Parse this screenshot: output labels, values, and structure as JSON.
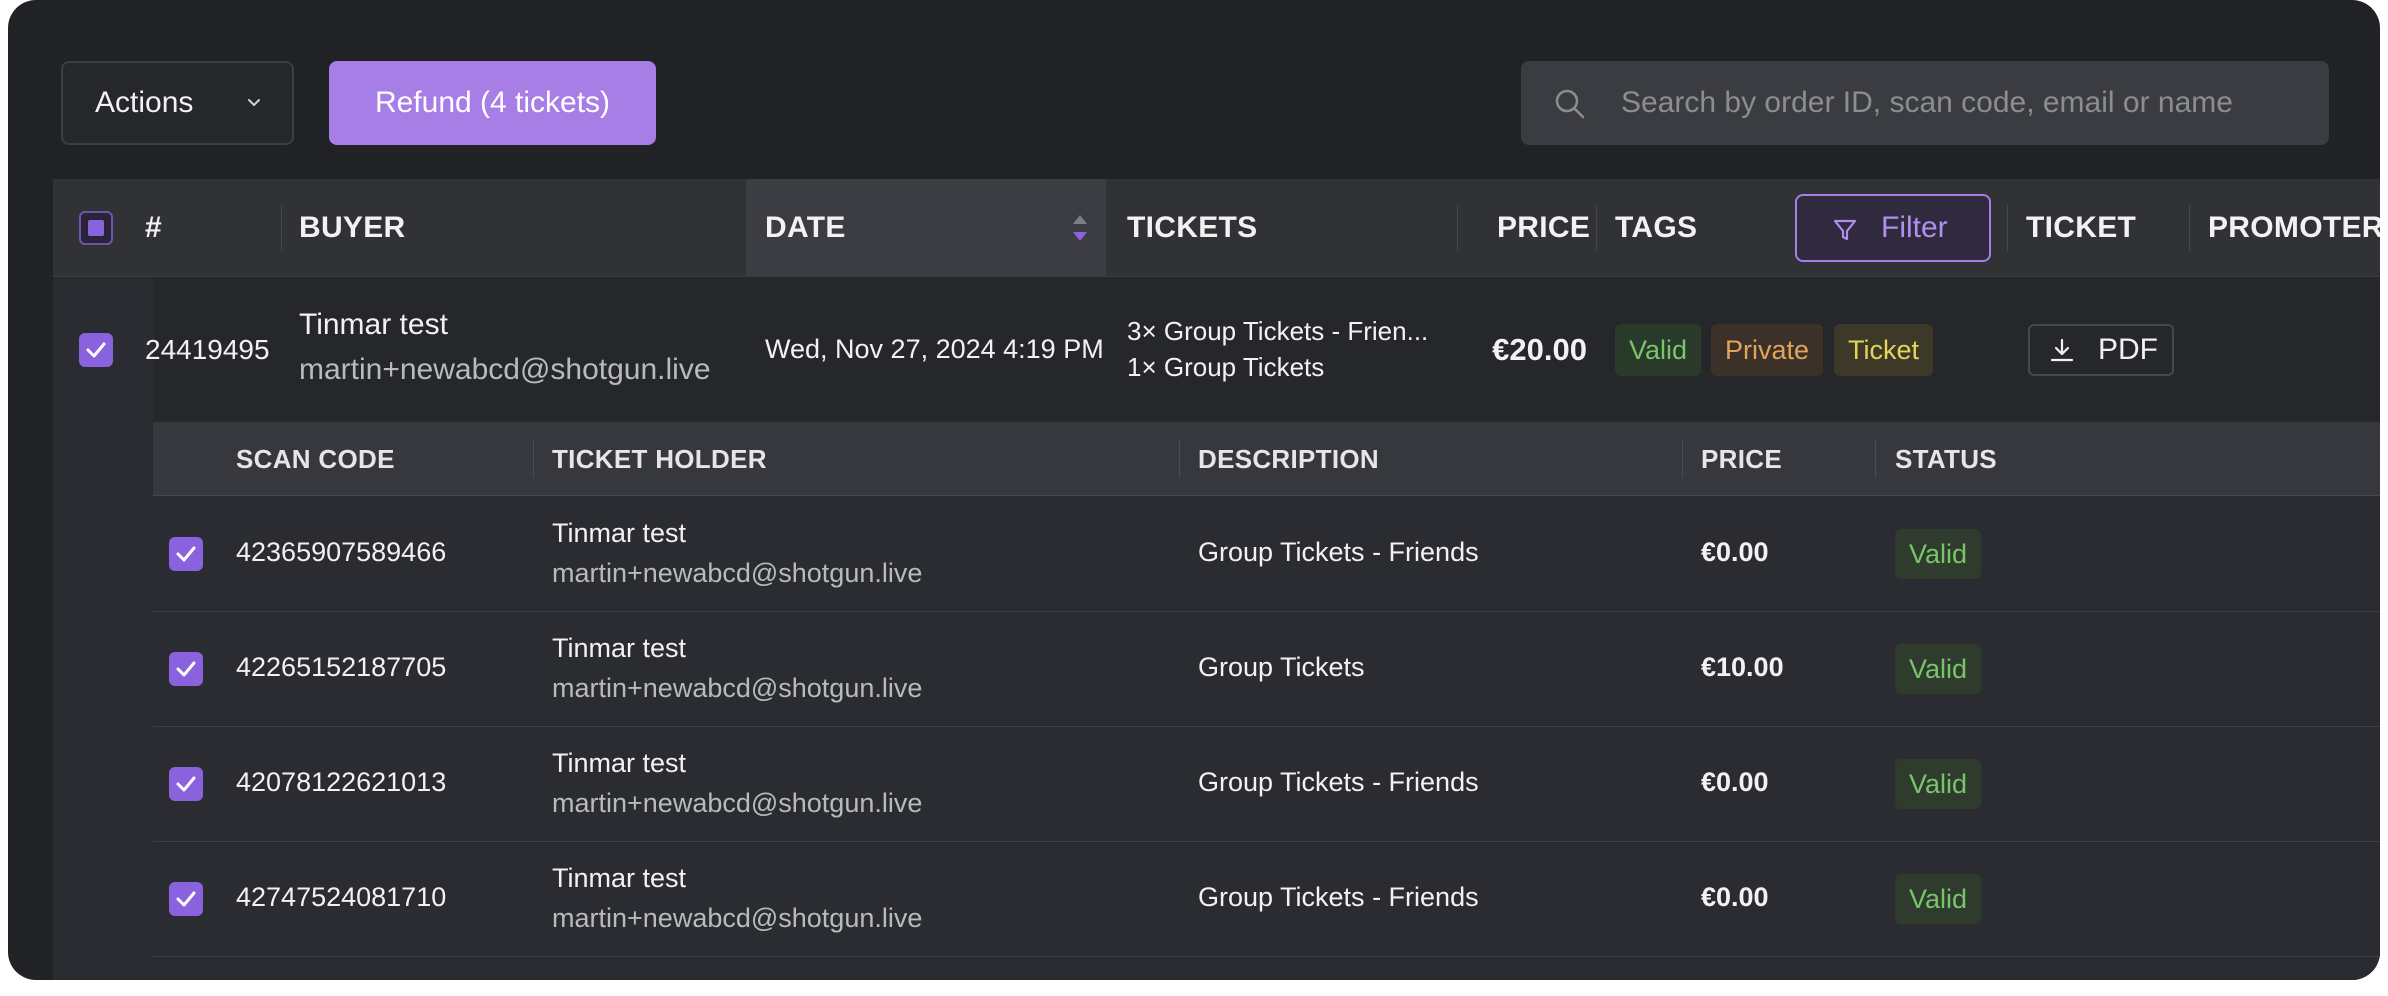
{
  "toolbar": {
    "actions_label": "Actions",
    "refund_label": "Refund (4 tickets)",
    "search_placeholder": "Search by order ID, scan code, email or name"
  },
  "columns": {
    "number": "#",
    "buyer": "BUYER",
    "date": "DATE",
    "tickets": "TICKETS",
    "price": "PRICE",
    "tags": "TAGS",
    "filter": "Filter",
    "ticket": "TICKET",
    "promoter": "PROMOTER"
  },
  "order": {
    "id": "24419495",
    "buyer_name": "Tinmar test",
    "buyer_email": "martin+newabcd@shotgun.live",
    "date": "Wed, Nov 27, 2024 4:19 PM",
    "tickets_line1": "3× Group Tickets - Frien...",
    "tickets_line2": "1× Group Tickets",
    "price": "€20.00",
    "tags": [
      "Valid",
      "Private",
      "Ticket"
    ],
    "pdf_label": "PDF"
  },
  "sub_columns": {
    "scan_code": "SCAN CODE",
    "holder": "TICKET HOLDER",
    "description": "DESCRIPTION",
    "price": "PRICE",
    "status": "STATUS"
  },
  "tickets": [
    {
      "scan_code": "42365907589466",
      "holder_name": "Tinmar test",
      "holder_email": "martin+newabcd@shotgun.live",
      "description": "Group Tickets - Friends",
      "price": "€0.00",
      "status": "Valid"
    },
    {
      "scan_code": "42265152187705",
      "holder_name": "Tinmar test",
      "holder_email": "martin+newabcd@shotgun.live",
      "description": "Group Tickets",
      "price": "€10.00",
      "status": "Valid"
    },
    {
      "scan_code": "42078122621013",
      "holder_name": "Tinmar test",
      "holder_email": "martin+newabcd@shotgun.live",
      "description": "Group Tickets - Friends",
      "price": "€0.00",
      "status": "Valid"
    },
    {
      "scan_code": "42747524081710",
      "holder_name": "Tinmar test",
      "holder_email": "martin+newabcd@shotgun.live",
      "description": "Group Tickets - Friends",
      "price": "€0.00",
      "status": "Valid"
    }
  ],
  "icons": {
    "actions_chevron": "chevron-down-icon",
    "search": "search-icon",
    "sort": "sort-icon",
    "filter": "filter-icon",
    "download": "download-icon",
    "check": "check-icon"
  },
  "colors": {
    "accent": "#a77de6",
    "valid": "#79c46b",
    "private": "#e2a45d",
    "ticket": "#e8d35a",
    "background": "#202226"
  }
}
